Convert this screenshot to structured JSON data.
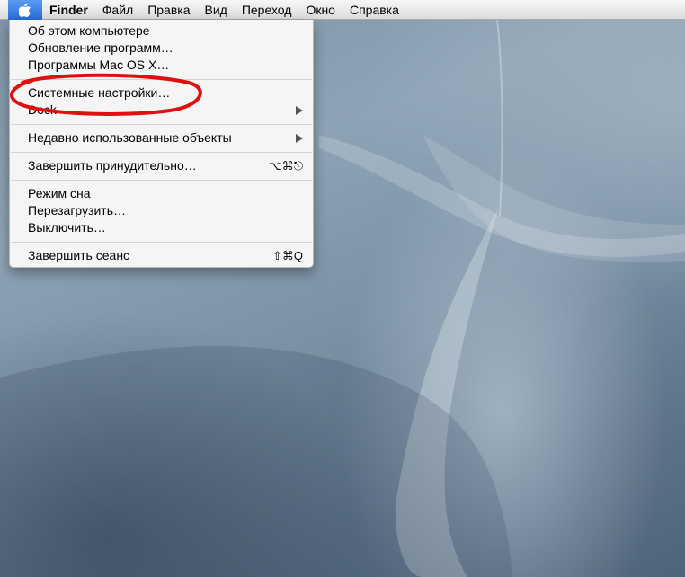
{
  "menubar": {
    "apple_icon": "apple-logo-icon",
    "app_name": "Finder",
    "items": [
      "Файл",
      "Правка",
      "Вид",
      "Переход",
      "Окно",
      "Справка"
    ]
  },
  "apple_menu": {
    "items": [
      {
        "label": "Об этом компьютере"
      },
      {
        "label": "Обновление программ…"
      },
      {
        "label": "Программы Mac OS X…"
      },
      {
        "label": "Системные настройки…"
      },
      {
        "label": "Dock",
        "submenu": true
      },
      {
        "label": "Недавно использованные объекты",
        "submenu": true
      },
      {
        "label": "Завершить принудительно…",
        "shortcut": "⌥⌘⎋"
      },
      {
        "label": "Режим сна"
      },
      {
        "label": "Перезагрузить…"
      },
      {
        "label": "Выключить…"
      },
      {
        "label": "Завершить сеанс",
        "shortcut": "⇧⌘Q"
      }
    ]
  },
  "annotation": {
    "type": "red-ellipse",
    "color": "#e01010",
    "target": "Системные настройки…"
  }
}
